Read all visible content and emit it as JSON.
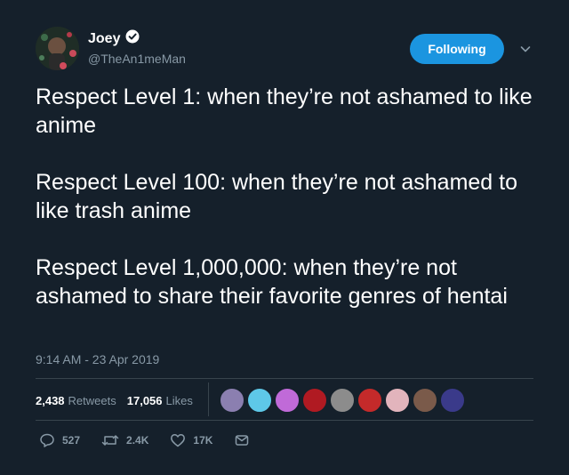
{
  "author": {
    "name": "Joey",
    "handle": "@TheAn1meMan",
    "verified": true
  },
  "follow_button": {
    "label": "Following",
    "color": "#1b95e0"
  },
  "tweet": {
    "paragraphs": [
      "Respect Level 1: when they’re not ashamed to like anime",
      "Respect Level 100: when they’re not ashamed to like trash anime",
      "Respect Level 1,000,000: when they’re not ashamed to share their favorite genres of hentai"
    ],
    "timestamp": "9:14 AM - 23 Apr 2019"
  },
  "stats": {
    "retweets_count": "2,438",
    "retweets_label": "Retweets",
    "likes_count": "17,056",
    "likes_label": "Likes"
  },
  "actions": {
    "replies": "527",
    "retweets": "2.4K",
    "likes": "17K"
  },
  "theme": {
    "background": "#15202b",
    "secondary_text": "#8899a6",
    "border": "#38444d"
  }
}
